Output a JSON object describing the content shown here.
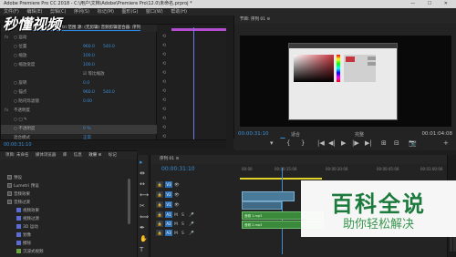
{
  "app": {
    "title": "Adobe Premiere Pro CC 2018 - C:\\用户\\文档\\Adobe\\Premiere Pro\\12.0\\未命名.prproj *",
    "window_controls": "—  ☐  ✕"
  },
  "menu": [
    "文件(F)",
    "编辑(E)",
    "剪辑(C)",
    "序列(S)",
    "标记(M)",
    "图形(G)",
    "窗口(W)",
    "帮助(H)"
  ],
  "watermark_top": "秒懂视频",
  "effect_controls": {
    "tab_label": "效果控件 ≡  Lumetri 范围  源: (无剪辑)  音频剪辑混合器: 序列",
    "rows": [
      {
        "icon": "fx",
        "label": "○ 运动",
        "v1": "",
        "v2": ""
      },
      {
        "icon": "",
        "label": "○ 位置",
        "v1": "960.0",
        "v2": "540.0"
      },
      {
        "icon": "",
        "label": "○ 缩放",
        "v1": "100.0",
        "v2": ""
      },
      {
        "icon": "",
        "label": "○ 缩放宽度",
        "v1": "100.0",
        "v2": ""
      },
      {
        "icon": "",
        "label": "☑ 等比缩放",
        "v1": "",
        "v2": ""
      },
      {
        "icon": "",
        "label": "○ 旋转",
        "v1": "0.0",
        "v2": ""
      },
      {
        "icon": "",
        "label": "○ 锚点",
        "v1": "960.0",
        "v2": "540.0"
      },
      {
        "icon": "",
        "label": "○ 防闪烁滤镜",
        "v1": "0.00",
        "v2": ""
      },
      {
        "icon": "fx",
        "label": "不透明度",
        "v1": "",
        "v2": ""
      },
      {
        "icon": "",
        "label": "○ □ ✎",
        "v1": "",
        "v2": ""
      },
      {
        "icon": "",
        "label": "○ 不透明度",
        "v1": "0 %",
        "v2": ""
      },
      {
        "icon": "",
        "label": "混合模式",
        "v1": "正常",
        "v2": ""
      }
    ],
    "timecode": "00:00:31:10"
  },
  "program_monitor": {
    "tab_label": "节目: 序列 01 ≡",
    "timecode": "00:00:31:10",
    "fit": "适合",
    "full": "完整",
    "duration": "00:01:04:08",
    "transport": [
      "▾",
      "|",
      "{",
      "}",
      "|◀",
      "◀|",
      "▶",
      "|▶",
      "▶|",
      "⊞",
      "⊟",
      "📷",
      "+"
    ]
  },
  "project": {
    "tabs": [
      "项目: 未命名",
      "媒体浏览器",
      "库",
      "信息",
      "效果 ≡",
      "标记"
    ],
    "active_tab": "效果 ≡",
    "items": [
      {
        "type": "folder",
        "label": "预设"
      },
      {
        "type": "folder",
        "label": "Lumetri 预设"
      },
      {
        "type": "folder",
        "label": "音频效果"
      },
      {
        "type": "folder",
        "label": "音频过渡"
      },
      {
        "type": "clip",
        "label": "视频效果"
      },
      {
        "type": "clip",
        "label": "视频过渡"
      },
      {
        "type": "clip",
        "label": "3D 运动"
      },
      {
        "type": "clip",
        "label": "划像"
      },
      {
        "type": "clip",
        "label": "擦除"
      },
      {
        "type": "green",
        "label": "沉浸式视频"
      }
    ]
  },
  "tools": [
    "▸",
    "⇹",
    "↔",
    "⟷",
    "✂",
    "⟺",
    "✒",
    "✋",
    "T"
  ],
  "timeline": {
    "tab_label": "序列 01 ≡",
    "timecode": "00:00:31:10",
    "ruler": [
      "00:00",
      "00:00:15:00",
      "00:00:30:00",
      "00:00:45:00",
      "00:01:00:00"
    ],
    "tracks": [
      {
        "name": "V3",
        "kind": "video"
      },
      {
        "name": "V2",
        "kind": "video"
      },
      {
        "name": "V1",
        "kind": "video"
      },
      {
        "name": "A1",
        "kind": "audio"
      },
      {
        "name": "A2",
        "kind": "audio"
      },
      {
        "name": "A3",
        "kind": "audio"
      }
    ],
    "clip_a1": "音频 1.mp3",
    "clip_a2": "音频 2.mp3"
  },
  "watermark": {
    "big": "百科全说",
    "small": "助你轻松解决"
  },
  "colors": {
    "accent": "#3b8fd8",
    "audio_clip": "#3b8a3b",
    "video_clip": "#4a7a9a",
    "watermark_green": "#1c7a3c"
  }
}
